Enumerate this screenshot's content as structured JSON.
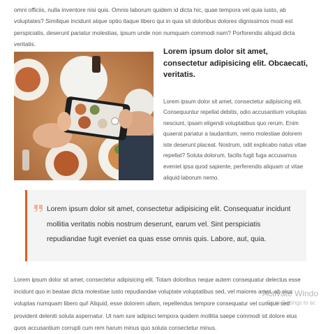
{
  "intro_text": "omni officiis, nulla inventore nisi quis. Omnis laborum quidem id dicta hic, quae tempora vel quia iusto, ab voluptates? Similique incidunt atque optio itaque libero qui in quia sit doloribus dolores dignissimos modi est perspiciatis, deserunt pariatur molestias, ipsum unde non numquam commodi nam? Porforendis aliquid dicta veritatis.",
  "feature": {
    "heading": "Lorem ipsum dolor sit amet, consectetur adipisicing elit. Obcaecati, veritatis.",
    "paragraph": "Lorem ipsum dolor sit amet, consectetur adipisicing elit. Consequuntur repellat debitis, odio accusantium voluptas nesciunt, ipsam eligendi voluptatibus quo rerum. Enim quaerat pariatur a laudantium, nemo molestiae dolorem iste deserunt placeat. Nostrum, odit explicabo natus vitae repellat? Soluta dolorum, facilis fugit fuga accusamus eveniet ipsa quod sapiente, perferendis aliquam ut vitae aliquid laborum nemo.",
    "image_icon": "photo-of-phone-photographing-food"
  },
  "quote": {
    "icon": "quote-icon",
    "text": "Lorem ipsum dolor sit amet, consectetur adipisicing elit. Consequatur incidunt mollitia veritatis nobis nostrum deserunt, earum vel. Sint perspiciatis repudiandae fugit eveniet ea quas esse omnis quis. Labore, aut, quia."
  },
  "body_text": "Lorem ipsum dolor sit amet, consectetur adipisicing elit. Totam doloribus neque autem consequatur delectus esse incidunt quo in beatae dicta molestiae iusto repudiandae voluptate voluptatibus sed, vel maiores amet, ab eius voluptas numquam libero qui! Aliquid, esse dolorem ullam, repellendus tempore consequatur vel cumque sed provident deleniti soluta aspernatur. Ut nam iure adipisci tempora quidem mollitia saepe commodi sit dolore eius quos accusantium corrupti cum rem harum minus quo soluta consectetur minus.",
  "watermark": {
    "line1": "Activate Windo",
    "line2": "Go to Settings to ac"
  },
  "colors": {
    "accent": "#e35b1f",
    "quote_bg": "#f4f4f4"
  }
}
